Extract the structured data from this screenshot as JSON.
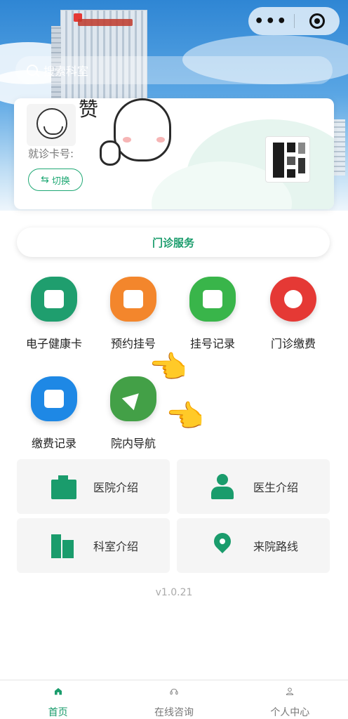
{
  "colors": {
    "primary": "#1a9c6c",
    "tile_bg": "#f5f5f5"
  },
  "header": {
    "search_placeholder": "搜索科室"
  },
  "capsule": {
    "menu_icon": "more-dots-icon",
    "close_icon": "target-circle-icon"
  },
  "card": {
    "label": "就诊卡号:",
    "switch_label": "切换",
    "sticker_text": "赞"
  },
  "service_bar": {
    "title": "门诊服务"
  },
  "services": [
    {
      "label": "电子健康卡",
      "icon": "health-card-icon",
      "color": "#1f9e6e"
    },
    {
      "label": "预约挂号",
      "icon": "calendar-clock-icon",
      "color": "#f3862c"
    },
    {
      "label": "挂号记录",
      "icon": "calendar-check-icon",
      "color": "#39b54a"
    },
    {
      "label": "门诊缴费",
      "icon": "payment-hand-icon",
      "color": "#e53935"
    },
    {
      "label": "缴费记录",
      "icon": "bill-record-icon",
      "color": "#1e88e5"
    },
    {
      "label": "院内导航",
      "icon": "navigation-arrow-icon",
      "color": "#43a047"
    }
  ],
  "tiles": [
    {
      "label": "医院介绍",
      "icon": "hospital-icon"
    },
    {
      "label": "医生介绍",
      "icon": "doctor-icon"
    },
    {
      "label": "科室介绍",
      "icon": "department-icon"
    },
    {
      "label": "来院路线",
      "icon": "map-pin-icon"
    }
  ],
  "version": "v1.0.21",
  "tabbar": [
    {
      "label": "首页",
      "icon": "home-icon",
      "active": true
    },
    {
      "label": "在线咨询",
      "icon": "headset-icon",
      "active": false
    },
    {
      "label": "个人中心",
      "icon": "user-icon",
      "active": false
    }
  ]
}
